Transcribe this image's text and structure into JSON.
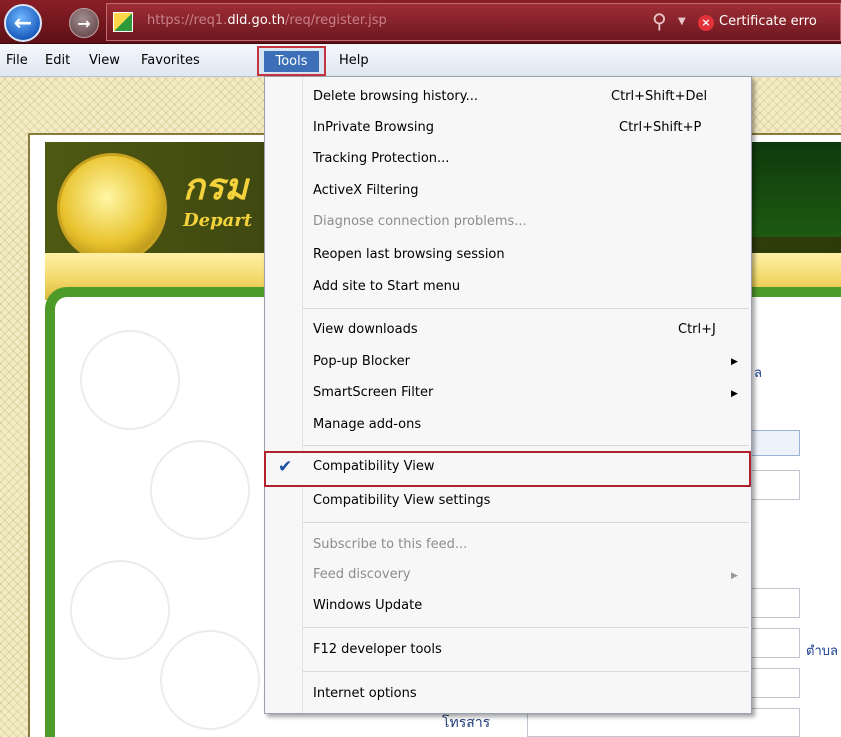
{
  "browser": {
    "url_prefix": "https://req1.",
    "url_host": "dld.go.th",
    "url_path": "/req/register.jsp",
    "cert_error_label": "Certificate erro",
    "colors": {
      "address_bar": "#8a1f26",
      "menu_highlight": "#3c6fb8",
      "callout_border": "#c5343f"
    }
  },
  "menu_bar": {
    "items": [
      {
        "label": "File"
      },
      {
        "label": "Edit"
      },
      {
        "label": "View"
      },
      {
        "label": "Favorites"
      },
      {
        "label": "Tools",
        "active": true
      },
      {
        "label": "Help"
      }
    ]
  },
  "tools_menu": {
    "items": [
      {
        "label": "Delete browsing history...",
        "shortcut": "Ctrl+Shift+Del"
      },
      {
        "label": "InPrivate Browsing",
        "shortcut": "Ctrl+Shift+P"
      },
      {
        "label": "Tracking Protection..."
      },
      {
        "label": "ActiveX Filtering"
      },
      {
        "label": "Diagnose connection problems...",
        "disabled": true
      },
      {
        "label": "Reopen last browsing session"
      },
      {
        "label": "Add site to Start menu"
      },
      {
        "label": "View downloads",
        "shortcut": "Ctrl+J"
      },
      {
        "label": "Pop-up Blocker",
        "submenu": true
      },
      {
        "label": "SmartScreen Filter",
        "submenu": true
      },
      {
        "label": "Manage add-ons"
      },
      {
        "label": "Compatibility View",
        "checked": true
      },
      {
        "label": "Compatibility View settings"
      },
      {
        "label": "Subscribe to this feed...",
        "disabled": true
      },
      {
        "label": "Feed discovery",
        "disabled": true,
        "submenu": true
      },
      {
        "label": "Windows Update"
      },
      {
        "label": "F12 developer tools"
      },
      {
        "label": "Internet options"
      }
    ]
  },
  "page": {
    "banner_thai": "กรม",
    "banner_english": "Depart",
    "side_text_1": "ล",
    "side_text_2": "ตำบล",
    "fax_label": "โทรสาร"
  }
}
